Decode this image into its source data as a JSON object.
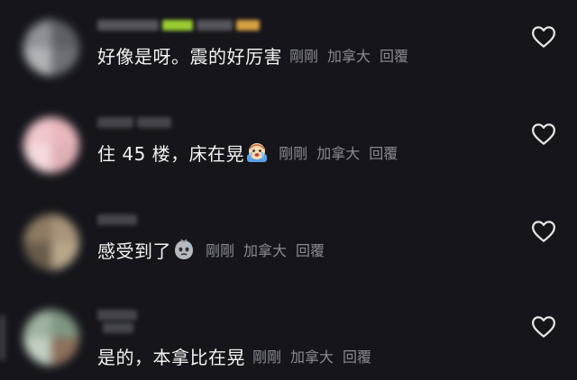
{
  "comments": [
    {
      "content": "好像是呀。震的好厉害",
      "time": "剛剛",
      "location": "加拿大",
      "reply": "回覆",
      "like_icon": "heart-outline-icon",
      "avatar_colors": [
        "#8f9297",
        "#5d6167",
        "#b0b3b7",
        "#6d7176"
      ],
      "name_colors": [
        "#55555c",
        "#9acd32",
        "#55555c",
        "#d4a040"
      ]
    },
    {
      "content": "住 45 楼，床在晃",
      "emoji": "crying-face-emoji",
      "time": "剛剛",
      "location": "加拿大",
      "reply": "回覆",
      "like_icon": "heart-outline-icon",
      "avatar_colors": [
        "#f0c7cc",
        "#e9b7bd",
        "#f6dadd",
        "#dfb0b6"
      ],
      "name_colors": [
        "#45454c",
        "#45454c"
      ]
    },
    {
      "content": "感受到了",
      "emoji": "sweat-face-emoji",
      "time": "剛剛",
      "location": "加拿大",
      "reply": "回覆",
      "like_icon": "heart-outline-icon",
      "avatar_colors": [
        "#8e7a62",
        "#a89479",
        "#6a5c4b",
        "#b8a689"
      ],
      "name_colors": [
        "#45454c"
      ]
    },
    {
      "content": "是的，本拿比在晃",
      "time": "剛剛",
      "location": "加拿大",
      "reply": "回覆",
      "like_icon": "heart-outline-icon",
      "avatar_colors": [
        "#9fb3a0",
        "#7f9683",
        "#c1cfc1",
        "#8c6f5c"
      ],
      "name_colors": [
        "#45454c",
        "#45454c"
      ]
    }
  ]
}
